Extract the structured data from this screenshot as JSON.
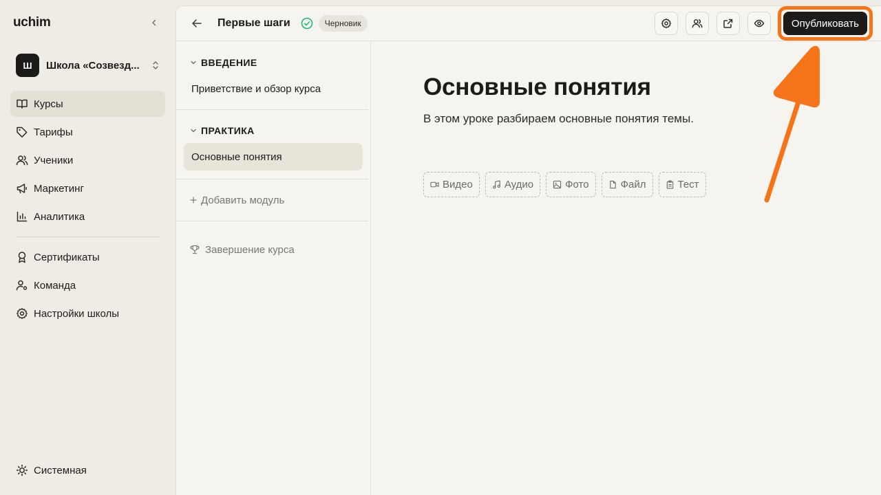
{
  "sidebar": {
    "brand": "uchim",
    "school": {
      "avatar_letter": "Ш",
      "name": "Школа «Созвезд..."
    },
    "items": [
      {
        "label": "Курсы",
        "icon": "book-open-icon",
        "active": true
      },
      {
        "label": "Тарифы",
        "icon": "tag-icon"
      },
      {
        "label": "Ученики",
        "icon": "users-icon"
      },
      {
        "label": "Маркетинг",
        "icon": "megaphone-icon"
      },
      {
        "label": "Аналитика",
        "icon": "bar-chart-icon"
      },
      {
        "label": "Сертификаты",
        "icon": "award-icon"
      },
      {
        "label": "Команда",
        "icon": "user-cog-icon"
      },
      {
        "label": "Настройки школы",
        "icon": "gear-icon"
      }
    ],
    "theme_label": "Системная"
  },
  "topbar": {
    "course_title": "Первые шаги",
    "status_badge": "Черновик",
    "publish_label": "Опубликовать"
  },
  "modules": {
    "list": [
      {
        "title": "ВВЕДЕНИЕ",
        "lessons": [
          "Приветствие и обзор курса"
        ]
      },
      {
        "title": "ПРАКТИКА",
        "lessons": [
          "Основные понятия"
        ]
      }
    ],
    "add_module_label": "Добавить модуль",
    "finish_label": "Завершение курса"
  },
  "lesson": {
    "title": "Основные понятия",
    "description": "В этом уроке разбираем основные понятия темы.",
    "blocks": [
      {
        "label": "Видео",
        "icon": "video-icon"
      },
      {
        "label": "Аудио",
        "icon": "music-icon"
      },
      {
        "label": "Фото",
        "icon": "image-icon"
      },
      {
        "label": "Файл",
        "icon": "file-icon"
      },
      {
        "label": "Тест",
        "icon": "clipboard-icon"
      }
    ]
  },
  "colors": {
    "accent": "#f57419",
    "success": "#22b573",
    "primary_button": "#1c1b19"
  }
}
